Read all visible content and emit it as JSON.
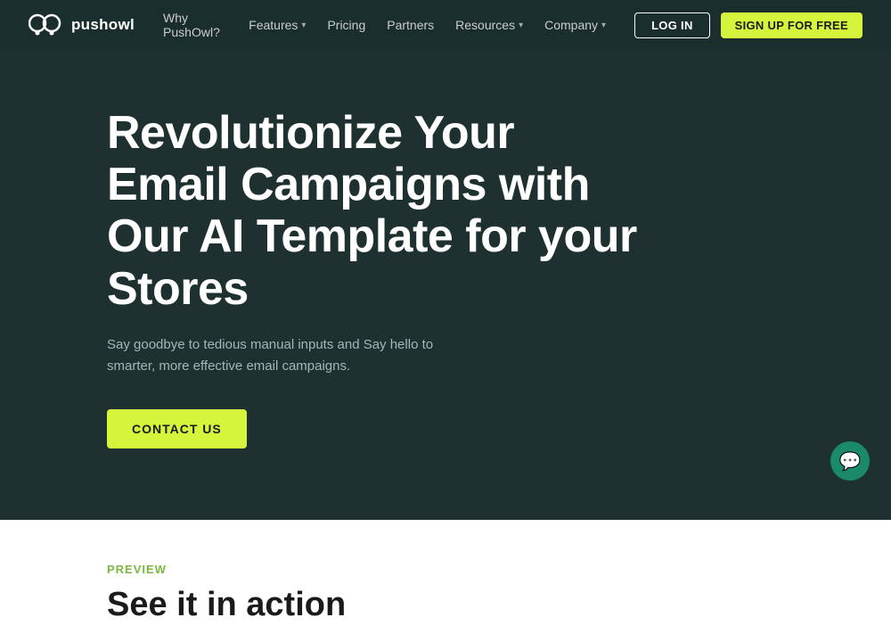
{
  "navbar": {
    "logo_text": "pushowl",
    "nav_items": [
      {
        "label": "Why PushOwl?",
        "has_arrow": false
      },
      {
        "label": "Features",
        "has_arrow": true
      },
      {
        "label": "Pricing",
        "has_arrow": false
      },
      {
        "label": "Partners",
        "has_arrow": false
      },
      {
        "label": "Resources",
        "has_arrow": true
      },
      {
        "label": "Company",
        "has_arrow": true
      }
    ],
    "login_label": "LOG IN",
    "signup_label": "SIGN UP FOR FREE"
  },
  "hero": {
    "title": "Revolutionize Your Email Campaigns with Our AI Template for your Stores",
    "subtitle": "Say goodbye to tedious manual inputs and Say hello to smarter, more effective email campaigns.",
    "cta_label": "CONTACT US"
  },
  "below_fold": {
    "preview_label": "PREVIEW",
    "section_title": "See it in action"
  },
  "chat": {
    "icon": "💬"
  }
}
